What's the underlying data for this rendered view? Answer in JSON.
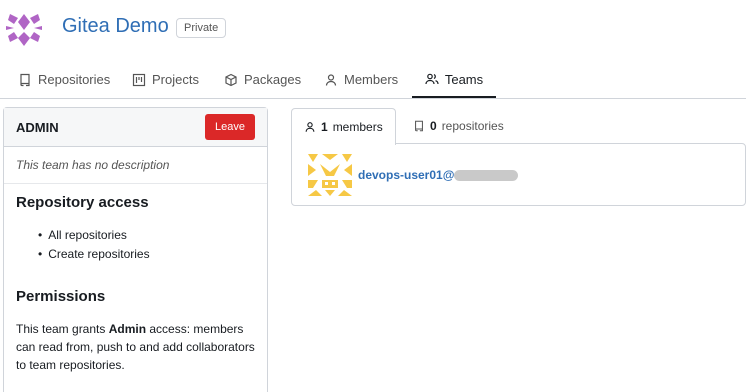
{
  "org": {
    "title": "Gitea Demo",
    "visibility_badge": "Private"
  },
  "tabs": [
    {
      "label": "Repositories",
      "icon": "repo-icon"
    },
    {
      "label": "Projects",
      "icon": "project-icon"
    },
    {
      "label": "Packages",
      "icon": "package-icon"
    },
    {
      "label": "Members",
      "icon": "person-icon"
    },
    {
      "label": "Teams",
      "icon": "people-icon",
      "active": true
    }
  ],
  "team": {
    "name": "ADMIN",
    "leave_label": "Leave",
    "description": "This team has no description",
    "repo_access_title": "Repository access",
    "repo_access_items": [
      "All repositories",
      "Create repositories"
    ],
    "permissions_title": "Permissions",
    "permissions_text_pre": "This team grants ",
    "permissions_text_bold": "Admin",
    "permissions_text_post": " access: members can read from, push to and add collaborators to team repositories."
  },
  "member_tabs": {
    "members_count": "1",
    "members_label": "members",
    "repos_count": "0",
    "repos_label": "repositories"
  },
  "members": [
    {
      "name": "devops-user01@"
    }
  ],
  "colors": {
    "link": "#2f6eb5",
    "danger": "#db2828",
    "logo": "#b065c5",
    "avatar": "#f6c845"
  }
}
